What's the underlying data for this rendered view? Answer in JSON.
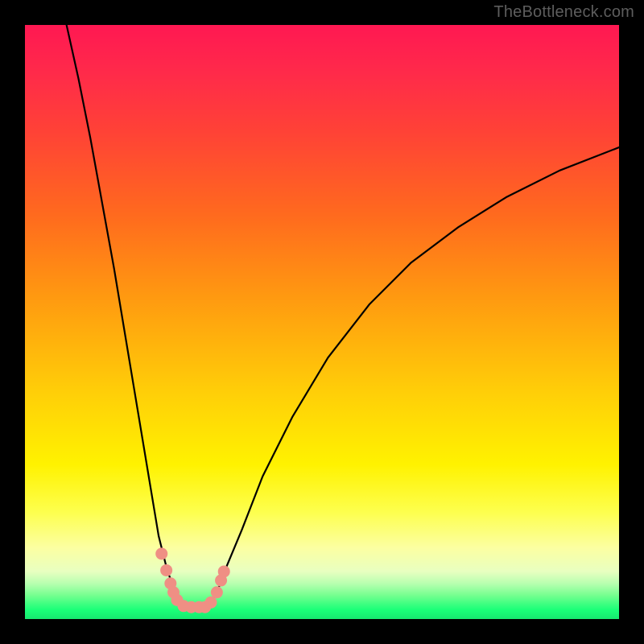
{
  "watermark": "TheBottleneck.com",
  "chart_data": {
    "type": "line",
    "title": "",
    "xlabel": "",
    "ylabel": "",
    "xlim": [
      0,
      100
    ],
    "ylim": [
      0,
      100
    ],
    "grid": false,
    "series": [
      {
        "name": "left-curve",
        "x": [
          7,
          9,
          11,
          13,
          15,
          17,
          19,
          21,
          22.5,
          24,
          25.2,
          26.3,
          27
        ],
        "y": [
          100,
          91,
          81,
          70,
          59,
          47,
          35,
          23,
          14,
          8,
          5,
          3,
          2
        ]
      },
      {
        "name": "right-curve",
        "x": [
          31,
          32.5,
          34,
          36.5,
          40,
          45,
          51,
          58,
          65,
          73,
          81,
          90,
          100
        ],
        "y": [
          2,
          5,
          9,
          15,
          24,
          34,
          44,
          53,
          60,
          66,
          71,
          75.5,
          79.4
        ]
      },
      {
        "name": "floor",
        "x": [
          27,
          31
        ],
        "y": [
          2,
          2
        ]
      }
    ],
    "markers": [
      {
        "x": 23.0,
        "y": 11.0
      },
      {
        "x": 23.8,
        "y": 8.2
      },
      {
        "x": 24.5,
        "y": 6.0
      },
      {
        "x": 25.0,
        "y": 4.5
      },
      {
        "x": 25.6,
        "y": 3.2
      },
      {
        "x": 26.7,
        "y": 2.2
      },
      {
        "x": 28.0,
        "y": 2.0
      },
      {
        "x": 29.3,
        "y": 2.0
      },
      {
        "x": 30.3,
        "y": 2.0
      },
      {
        "x": 31.3,
        "y": 2.8
      },
      {
        "x": 32.3,
        "y": 4.5
      },
      {
        "x": 33.0,
        "y": 6.5
      },
      {
        "x": 33.5,
        "y": 8.0
      }
    ],
    "background_gradient": {
      "direction": "top-to-bottom",
      "stops": [
        {
          "pos": 0.0,
          "color": "#ff1852"
        },
        {
          "pos": 0.32,
          "color": "#ff6a1e"
        },
        {
          "pos": 0.62,
          "color": "#ffcf08"
        },
        {
          "pos": 0.82,
          "color": "#fdff4e"
        },
        {
          "pos": 0.94,
          "color": "#b8ffb0"
        },
        {
          "pos": 1.0,
          "color": "#17e86f"
        }
      ]
    }
  }
}
